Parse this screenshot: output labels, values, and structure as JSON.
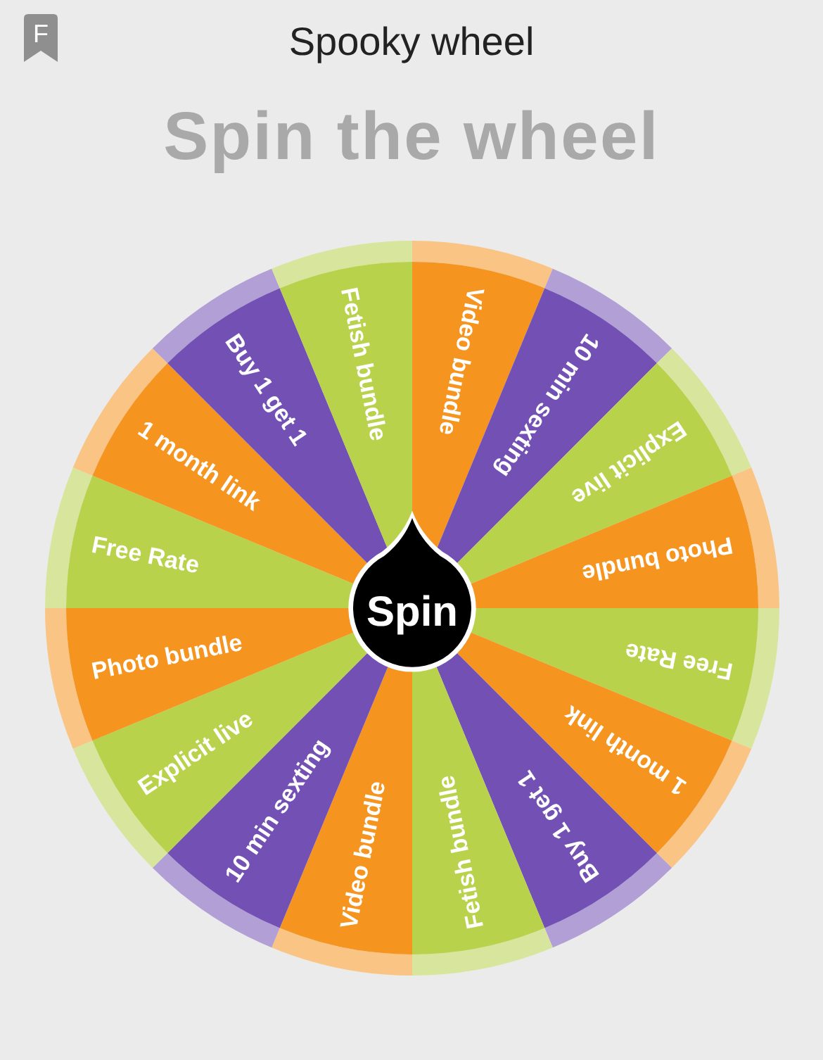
{
  "app_badge": "F",
  "window": {
    "title": "Spooky wheel"
  },
  "heading": "Spin the wheel",
  "wheel": {
    "spin_button": "Spin",
    "segments": [
      {
        "label": "Video bundle",
        "color": "#f5941f"
      },
      {
        "label": "10 min sexting",
        "color": "#7250b4"
      },
      {
        "label": "Explicit live",
        "color": "#b8d24c"
      },
      {
        "label": "Photo bundle",
        "color": "#f5941f"
      },
      {
        "label": "Free Rate",
        "color": "#b8d24c"
      },
      {
        "label": "1 month link",
        "color": "#f5941f"
      },
      {
        "label": "Buy 1 get 1",
        "color": "#7250b4"
      },
      {
        "label": "Fetish bundle",
        "color": "#b8d24c"
      },
      {
        "label": "Video bundle",
        "color": "#f5941f"
      },
      {
        "label": "10 min sexting",
        "color": "#7250b4"
      },
      {
        "label": "Explicit live",
        "color": "#b8d24c"
      },
      {
        "label": "Photo bundle",
        "color": "#f5941f"
      },
      {
        "label": "Free Rate",
        "color": "#b8d24c"
      },
      {
        "label": "1 month link",
        "color": "#f5941f"
      },
      {
        "label": "Buy 1 get 1",
        "color": "#7250b4"
      },
      {
        "label": "Fetish bundle",
        "color": "#b8d24c"
      }
    ]
  }
}
